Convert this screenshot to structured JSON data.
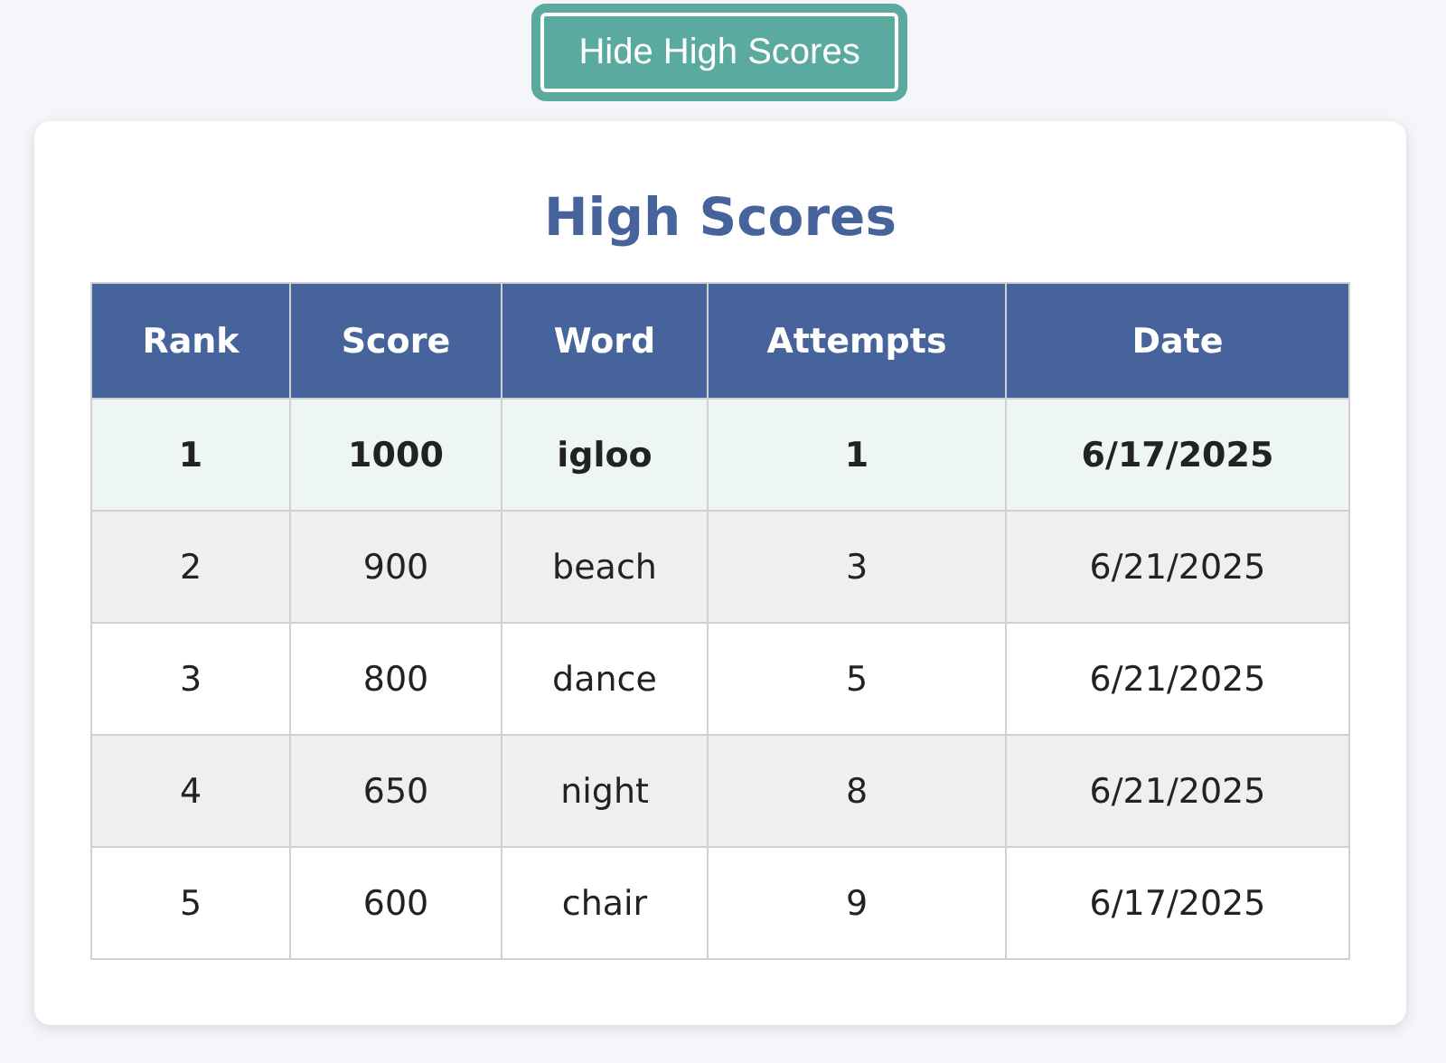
{
  "toggle_button": {
    "label": "Hide High Scores"
  },
  "scores": {
    "title": "High Scores",
    "columns": [
      "Rank",
      "Score",
      "Word",
      "Attempts",
      "Date"
    ],
    "rows": [
      {
        "highlighted": true,
        "cells": [
          "1",
          "1000",
          "igloo",
          "1",
          "6/17/2025"
        ]
      },
      {
        "highlighted": false,
        "cells": [
          "2",
          "900",
          "beach",
          "3",
          "6/21/2025"
        ]
      },
      {
        "highlighted": false,
        "cells": [
          "3",
          "800",
          "dance",
          "5",
          "6/21/2025"
        ]
      },
      {
        "highlighted": false,
        "cells": [
          "4",
          "650",
          "night",
          "8",
          "6/21/2025"
        ]
      },
      {
        "highlighted": false,
        "cells": [
          "5",
          "600",
          "chair",
          "9",
          "6/17/2025"
        ]
      }
    ]
  }
}
